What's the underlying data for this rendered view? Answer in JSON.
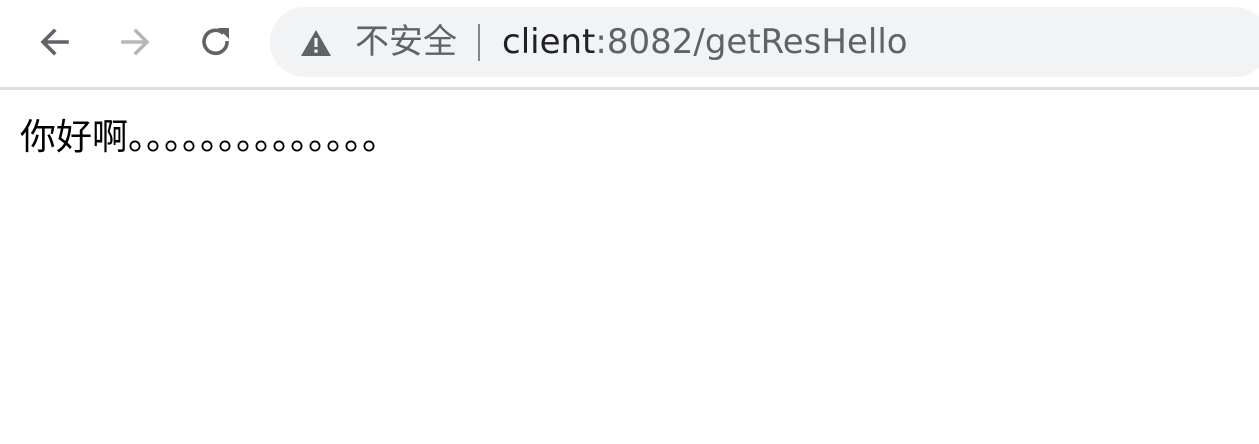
{
  "browser": {
    "nav": {
      "back_icon": "arrow-left-icon",
      "forward_icon": "arrow-right-icon",
      "reload_icon": "reload-icon"
    },
    "omnibox": {
      "security_icon": "warning-triangle-icon",
      "security_label": "不安全",
      "url_host": "client",
      "url_path": ":8082/getResHello"
    },
    "colors": {
      "omnibox_bg": "#f1f3f4",
      "icon_active": "#5f6368",
      "icon_disabled": "#b5b8bb",
      "text_primary": "#202124"
    }
  },
  "page": {
    "body_text": "你好啊。。。。。。。。。。。。。。"
  }
}
